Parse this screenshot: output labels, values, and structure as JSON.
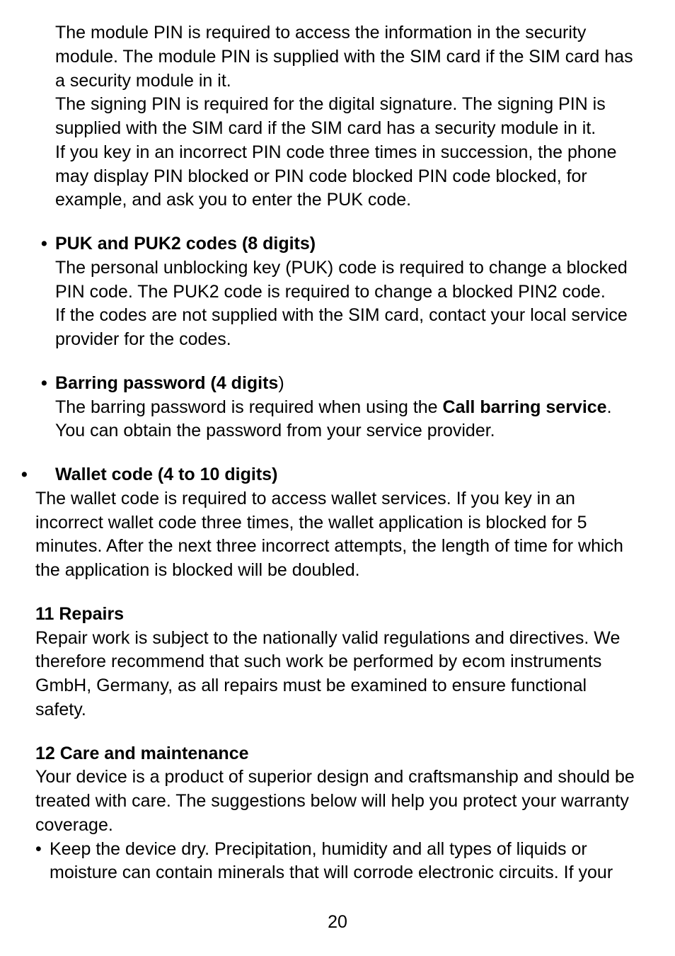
{
  "section1": {
    "para1": "The module PIN is required to access the information in the security module. The module PIN is supplied with the SIM card if the SIM card has a security module in it.",
    "para2": "The signing PIN is required for the digital signature. The signing PIN is supplied with the SIM card if the SIM card has a security module in it.",
    "para3": "If you key in an incorrect PIN code three times in succession, the phone may display PIN blocked or PIN code blocked PIN code blocked, for example, and ask you to enter the PUK code."
  },
  "section2": {
    "heading": "PUK and PUK2 codes (8 digits)",
    "para1": "The personal unblocking key (PUK) code is required to change a blocked PIN code. The PUK2 code is required to change a blocked PIN2 code.",
    "para2": "If the codes are not supplied with the SIM card, contact your local service provider for the codes."
  },
  "section3": {
    "heading_bold": "Barring password (4 digits",
    "heading_close": ")",
    "para1_pre": "The barring password is required when using the ",
    "para1_bold": "Call barring service",
    "para1_post": ". You can obtain the password from your service provider."
  },
  "section4": {
    "heading": "Wallet code (4 to 10 digits)",
    "body": "The wallet code is required to access wallet services. If you key in an incorrect wallet code three times, the wallet application is blocked for 5 minutes. After the next three incorrect attempts, the length of time for which the application is blocked will be doubled."
  },
  "section5": {
    "heading": "11 Repairs",
    "body": "Repair work is subject to the nationally valid regulations and directives. We therefore recommend that such work be performed by ecom instruments GmbH, Germany, as all repairs must be examined to ensure functional safety."
  },
  "section6": {
    "heading": "12 Care and maintenance",
    "body": "Your device is a product of superior design and craftsmanship and should be treated with care. The suggestions below will help you protect your warranty coverage.",
    "bullet1": "Keep the device dry. Precipitation, humidity and all types of liquids or moisture can contain minerals that will corrode electronic circuits. If your"
  },
  "page_number": "20"
}
